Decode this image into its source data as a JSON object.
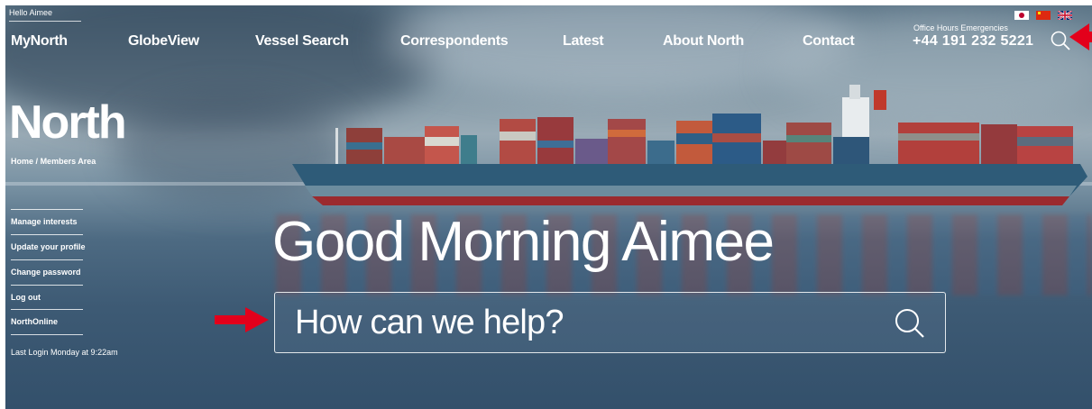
{
  "greeting_small": "Hello Aimee",
  "nav": {
    "items": [
      "MyNorth",
      "GlobeView",
      "Vessel Search",
      "Correspondents",
      "Latest",
      "About North",
      "Contact"
    ]
  },
  "emergency": {
    "label": "Office Hours Emergencies",
    "phone": "+44 191 232 5221"
  },
  "languages": [
    "Japanese flag",
    "Chinese flag",
    "UK flag"
  ],
  "logo": "North",
  "breadcrumb": {
    "home": "Home",
    "separator": "/",
    "current": "Members Area"
  },
  "sidebar": {
    "items": [
      "Manage interests",
      "Update your profile",
      "Change password",
      "Log out",
      "NorthOnline"
    ],
    "last_login": "Last Login Monday at 9:22am"
  },
  "hero": {
    "title": "Good Morning Aimee",
    "search_placeholder": "How can we help?"
  },
  "colors": {
    "annotation_red": "#e3001b",
    "hull_red": "#9b2a2e",
    "hull_blue": "#2e5b78"
  },
  "icons": [
    "search-icon",
    "arrow-icon"
  ]
}
